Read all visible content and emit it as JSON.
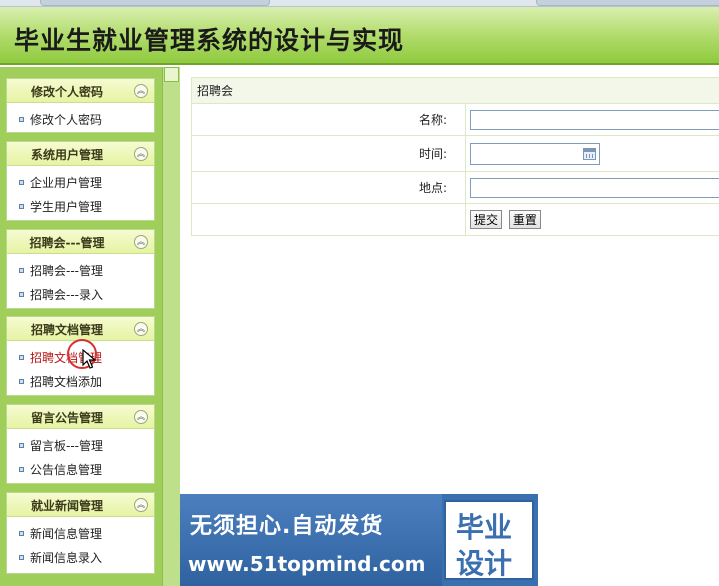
{
  "header": {
    "title": "毕业生就业管理系统的设计与实现"
  },
  "sidebar": {
    "groups": [
      {
        "title": "修改个人密码",
        "items": [
          {
            "label": "修改个人密码"
          }
        ]
      },
      {
        "title": "系统用户管理",
        "items": [
          {
            "label": "企业用户管理"
          },
          {
            "label": "学生用户管理"
          }
        ]
      },
      {
        "title": "招聘会---管理",
        "items": [
          {
            "label": "招聘会---管理"
          },
          {
            "label": "招聘会---录入"
          }
        ]
      },
      {
        "title": "招聘文档管理",
        "items": [
          {
            "label": "招聘文档管理"
          },
          {
            "label": "招聘文档添加"
          }
        ]
      },
      {
        "title": "留言公告管理",
        "items": [
          {
            "label": "留言板---管理"
          },
          {
            "label": "公告信息管理"
          }
        ]
      },
      {
        "title": "就业新闻管理",
        "items": [
          {
            "label": "新闻信息管理"
          },
          {
            "label": "新闻信息录入"
          }
        ]
      }
    ],
    "active_item": "招聘文档管理"
  },
  "form": {
    "caption": "招聘会",
    "name_label": "名称:",
    "name_value": "",
    "time_label": "时间:",
    "time_value": "",
    "place_label": "地点:",
    "place_value": "",
    "submit_label": "提交",
    "reset_label": "重置"
  },
  "ad": {
    "slogan": "无须担心.自动发货",
    "url": "www.51topmind.com",
    "badge_line1": "毕业",
    "badge_line2": "设计"
  },
  "icons": [
    "collapse-icon",
    "calendar-icon",
    "bullet-icon",
    "cursor-icon"
  ],
  "colors": {
    "header_green": "#8fca3e",
    "sidebar_green": "#9fcf5a",
    "active_red": "#b81414",
    "ad_blue": "#3a6fb0"
  }
}
